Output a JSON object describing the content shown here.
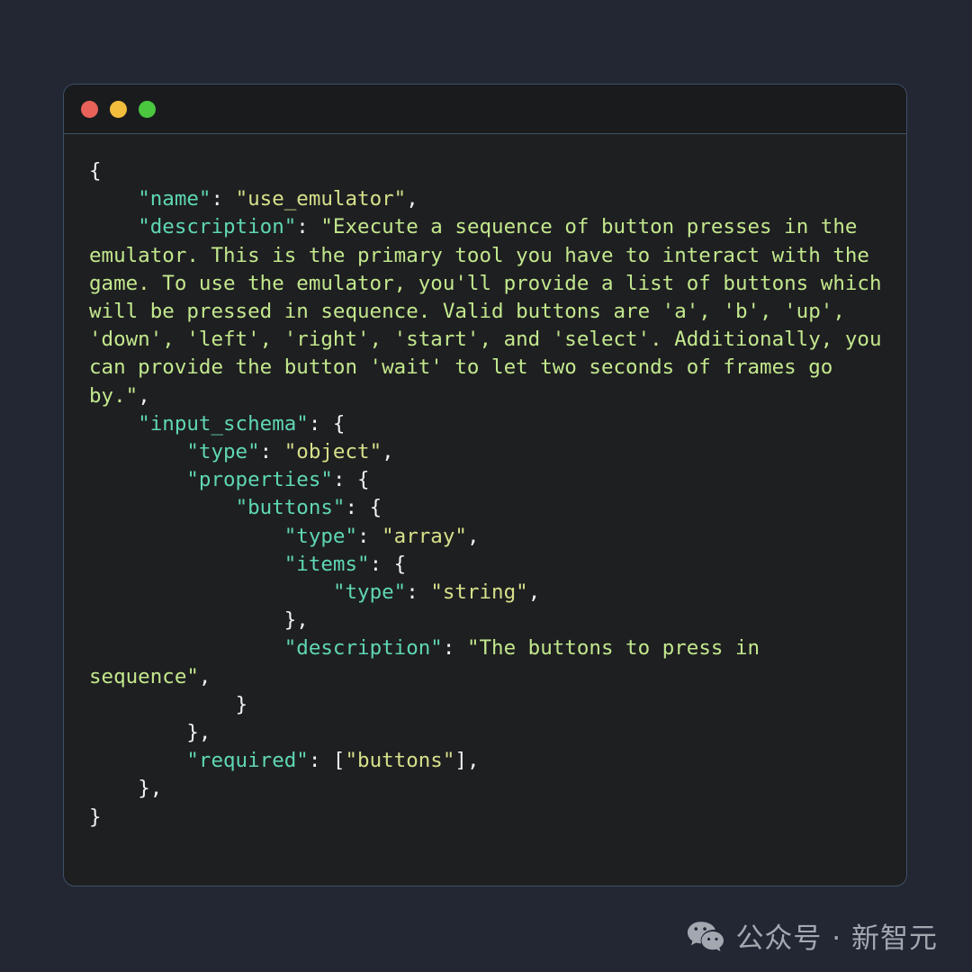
{
  "window": {
    "traffic_lights": [
      {
        "name": "close",
        "color": "#e8625a"
      },
      {
        "name": "minimize",
        "color": "#f2bd3c"
      },
      {
        "name": "maximize",
        "color": "#4ac73f"
      }
    ]
  },
  "code": {
    "language": "json",
    "lines": [
      {
        "indent": 0,
        "segments": [
          {
            "type": "punc",
            "text": "{"
          }
        ]
      },
      {
        "indent": 4,
        "segments": [
          {
            "type": "key",
            "text": "\"name\""
          },
          {
            "type": "punc",
            "text": ": "
          },
          {
            "type": "val",
            "text": "\"use_emulator\""
          },
          {
            "type": "punc",
            "text": ","
          }
        ]
      },
      {
        "indent": 4,
        "segments": [
          {
            "type": "key",
            "text": "\"description\""
          },
          {
            "type": "punc",
            "text": ": "
          },
          {
            "type": "str",
            "text": "\"Execute a sequence of button presses in the emulator. This is the primary tool you have to interact with the game. To use the emulator, you'll provide a list of buttons which will be pressed in sequence. Valid buttons are 'a', 'b', 'up', 'down', 'left', 'right', 'start', and 'select'. Additionally, you can provide the button 'wait' to let two seconds of frames go by.\""
          },
          {
            "type": "punc",
            "text": ","
          }
        ]
      },
      {
        "indent": 4,
        "segments": [
          {
            "type": "key",
            "text": "\"input_schema\""
          },
          {
            "type": "punc",
            "text": ": {"
          }
        ]
      },
      {
        "indent": 8,
        "segments": [
          {
            "type": "key",
            "text": "\"type\""
          },
          {
            "type": "punc",
            "text": ": "
          },
          {
            "type": "val",
            "text": "\"object\""
          },
          {
            "type": "punc",
            "text": ","
          }
        ]
      },
      {
        "indent": 8,
        "segments": [
          {
            "type": "key",
            "text": "\"properties\""
          },
          {
            "type": "punc",
            "text": ": {"
          }
        ]
      },
      {
        "indent": 12,
        "segments": [
          {
            "type": "key",
            "text": "\"buttons\""
          },
          {
            "type": "punc",
            "text": ": {"
          }
        ]
      },
      {
        "indent": 16,
        "segments": [
          {
            "type": "key",
            "text": "\"type\""
          },
          {
            "type": "punc",
            "text": ": "
          },
          {
            "type": "val",
            "text": "\"array\""
          },
          {
            "type": "punc",
            "text": ","
          }
        ]
      },
      {
        "indent": 16,
        "segments": [
          {
            "type": "key",
            "text": "\"items\""
          },
          {
            "type": "punc",
            "text": ": {"
          }
        ]
      },
      {
        "indent": 20,
        "segments": [
          {
            "type": "key",
            "text": "\"type\""
          },
          {
            "type": "punc",
            "text": ": "
          },
          {
            "type": "val",
            "text": "\"string\""
          },
          {
            "type": "punc",
            "text": ","
          }
        ]
      },
      {
        "indent": 16,
        "segments": [
          {
            "type": "punc",
            "text": "},"
          }
        ]
      },
      {
        "indent": 16,
        "segments": [
          {
            "type": "key",
            "text": "\"description\""
          },
          {
            "type": "punc",
            "text": ": "
          },
          {
            "type": "str",
            "text": "\"The buttons to press in sequence\""
          },
          {
            "type": "punc",
            "text": ","
          }
        ]
      },
      {
        "indent": 12,
        "segments": [
          {
            "type": "punc",
            "text": "}"
          }
        ]
      },
      {
        "indent": 8,
        "segments": [
          {
            "type": "punc",
            "text": "},"
          }
        ]
      },
      {
        "indent": 8,
        "segments": [
          {
            "type": "key",
            "text": "\"required\""
          },
          {
            "type": "punc",
            "text": ": ["
          },
          {
            "type": "val",
            "text": "\"buttons\""
          },
          {
            "type": "punc",
            "text": "],"
          }
        ]
      },
      {
        "indent": 4,
        "segments": [
          {
            "type": "punc",
            "text": "},"
          }
        ]
      },
      {
        "indent": 0,
        "segments": [
          {
            "type": "punc",
            "text": "}"
          }
        ]
      }
    ]
  },
  "watermark": {
    "icon": "wechat-icon",
    "text": "公众号 · 新智元"
  },
  "colors": {
    "page_background": "#222733",
    "card_background": "#1e1f21",
    "titlebar_background": "#1a1b1d",
    "card_border": "#3d5068",
    "key": "#5fd7b4",
    "string": "#c3e88d",
    "value": "#d7e08a",
    "punctuation": "#f2f2f2",
    "watermark_text": "#c8ccd4"
  }
}
